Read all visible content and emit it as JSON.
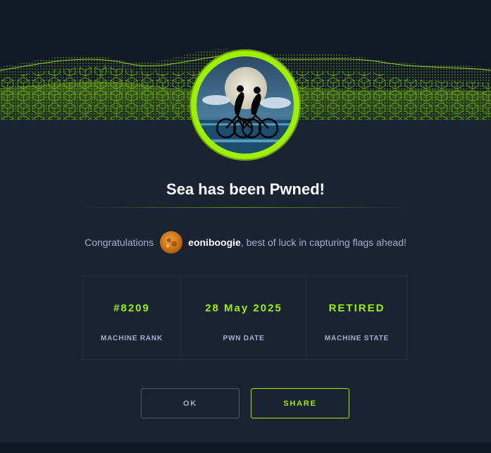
{
  "modal": {
    "title": "Sea has been Pwned!",
    "congrats_prefix": "Congratulations",
    "username": "eoniboogie",
    "congrats_suffix": ", best of luck in capturing flags ahead!"
  },
  "stats": [
    {
      "value": "#8209",
      "label": "MACHINE RANK"
    },
    {
      "value": "28 May 2025",
      "label": "PWN DATE"
    },
    {
      "value": "RETIRED",
      "label": "MACHINE STATE"
    }
  ],
  "buttons": {
    "ok_label": "OK",
    "share_label": "SHARE"
  },
  "colors": {
    "accent": "#9fef00",
    "background": "#1a2332",
    "muted_text": "#a4b1cd"
  },
  "icons": {
    "machine_avatar": "machine-avatar-icon",
    "user_avatar": "user-avatar-icon"
  }
}
